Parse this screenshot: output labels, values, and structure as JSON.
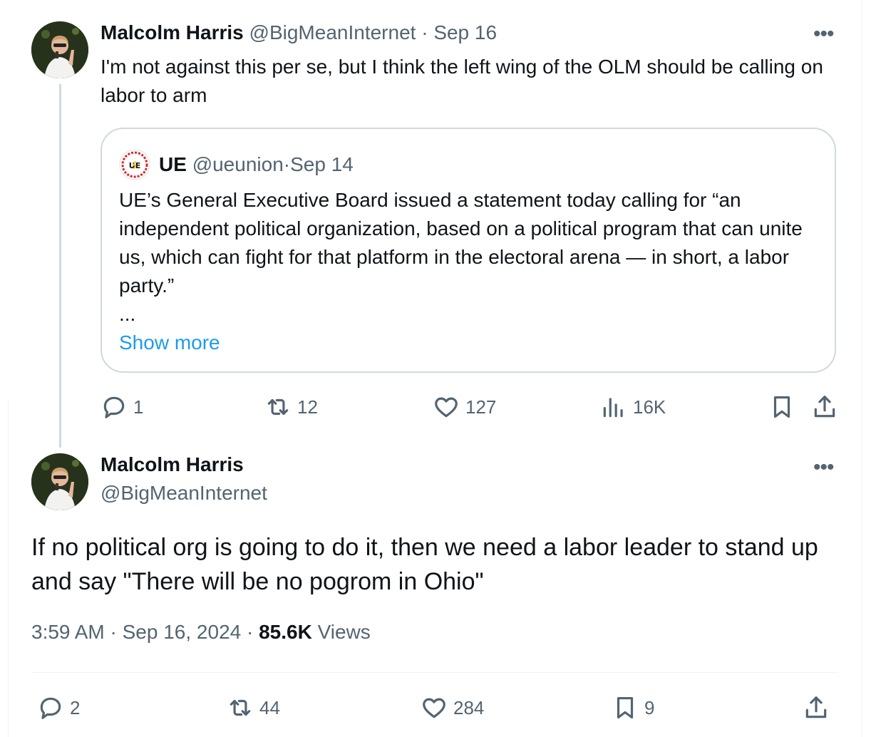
{
  "tweet1": {
    "name": "Malcolm Harris",
    "handle": "@BigMeanInternet",
    "sep": " · ",
    "date": "Sep 16",
    "text": "I'm not against this per se, but I think the left wing of the OLM should be calling on labor to arm",
    "quote": {
      "name": "UE",
      "handle": "@ueunion",
      "date": "Sep 14",
      "text": "UE’s General Executive Board issued a statement today calling for “an independent political organization, based on a political program that can unite us, which can fight for that platform in the electoral arena — in short, a labor party.”",
      "ellipsis": "...",
      "show_more": "Show more"
    },
    "actions": {
      "replies": "1",
      "reposts": "12",
      "likes": "127",
      "views": "16K"
    }
  },
  "tweet2": {
    "name": "Malcolm Harris",
    "handle": "@BigMeanInternet",
    "text": "If no political org is going to do it, then we need a labor leader to stand up and say \"There will be no pogrom in Ohio\"",
    "time": "3:59 AM",
    "date": "Sep 16, 2024",
    "views_count": "85.6K",
    "views_label": "Views",
    "actions": {
      "replies": "2",
      "reposts": "44",
      "likes": "284",
      "bookmarks": "9"
    }
  },
  "icons": [
    "more-icon",
    "reply-icon",
    "repost-icon",
    "like-icon",
    "views-icon",
    "bookmark-icon",
    "share-icon"
  ],
  "colors": {
    "accent": "#1d9bf0",
    "muted": "#536471",
    "text": "#0f1419",
    "border": "#cfd9de"
  }
}
